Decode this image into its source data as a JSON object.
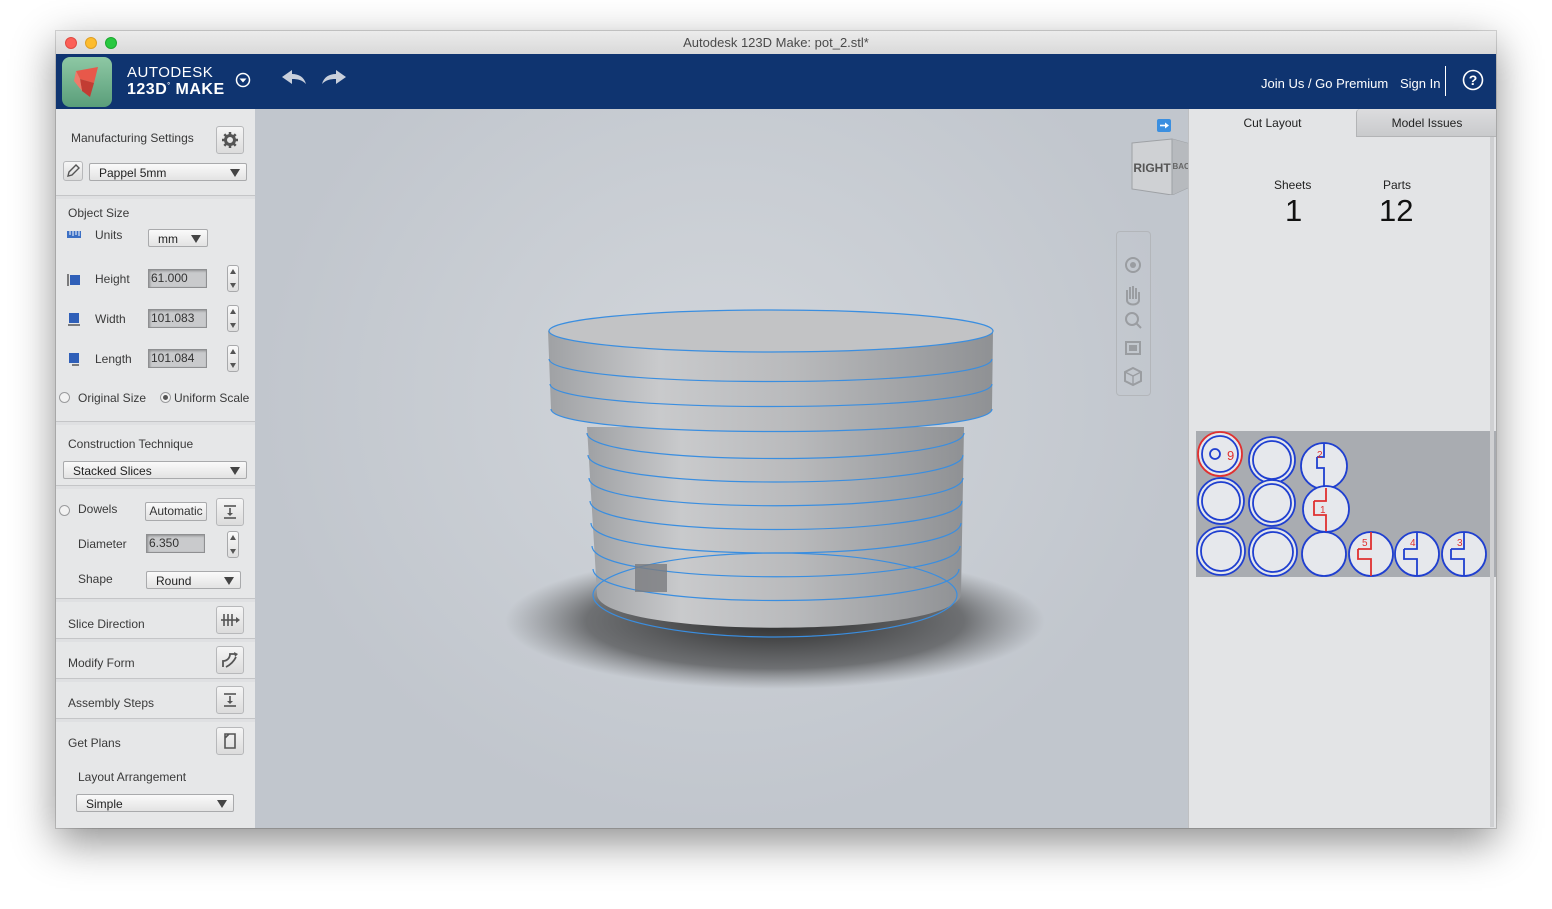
{
  "window": {
    "title": "Autodesk 123D Make: pot_2.stl*"
  },
  "appbar": {
    "brand_line1": "AUTODESK",
    "brand_line2": "123D",
    "brand_line3": "MAKE",
    "join_label": "Join Us / Go Premium",
    "signin_label": "Sign In",
    "help_label": "?"
  },
  "left": {
    "manufacturing_settings": "Manufacturing Settings",
    "material": "Pappel 5mm",
    "object_size": "Object Size",
    "units_label": "Units",
    "units_value": "mm",
    "height_label": "Height",
    "height_value": "61.000",
    "width_label": "Width",
    "width_value": "101.083",
    "length_label": "Length",
    "length_value": "101.084",
    "original_size": "Original Size",
    "uniform_scale": "Uniform Scale",
    "construction_technique": "Construction Technique",
    "technique_value": "Stacked Slices",
    "dowels_label": "Dowels",
    "dowels_value": "Automatic",
    "diameter_label": "Diameter",
    "diameter_value": "6.350",
    "shape_label": "Shape",
    "shape_value": "Round",
    "slice_direction": "Slice Direction",
    "modify_form": "Modify Form",
    "assembly_steps": "Assembly Steps",
    "get_plans": "Get Plans",
    "layout_arrangement": "Layout Arrangement",
    "layout_value": "Simple"
  },
  "viewport": {
    "viewcube_right": "RIGHT",
    "viewcube_back": "BACK"
  },
  "right": {
    "tab_cut_layout": "Cut Layout",
    "tab_model_issues": "Model Issues",
    "sheets_label": "Sheets",
    "sheets_value": "1",
    "parts_label": "Parts",
    "parts_value": "12",
    "part_numbers": [
      "9",
      "2",
      "1",
      "5",
      "4",
      "3"
    ]
  },
  "colors": {
    "appbar": "#0f3470",
    "slice_line": "#3a8ee0",
    "part_outline": "#1f3fd0",
    "part_label": "#e03030"
  }
}
